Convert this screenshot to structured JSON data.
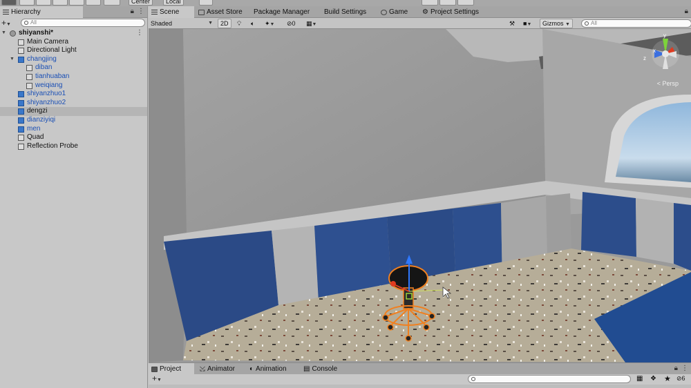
{
  "toolbar": {
    "center_label": "Center",
    "local_label": "Local"
  },
  "hierarchy": {
    "tab_label": "Hierarchy",
    "search_placeholder": "All",
    "items": [
      {
        "label": "shiyanshi*",
        "depth": 0,
        "expanded": true,
        "kind": "scene",
        "bold": true,
        "blue": false
      },
      {
        "label": "Main Camera",
        "depth": 1,
        "kind": "object",
        "blue": false
      },
      {
        "label": "Directional Light",
        "depth": 1,
        "kind": "object",
        "blue": false
      },
      {
        "label": "changjing",
        "depth": 1,
        "expanded": true,
        "kind": "prefab",
        "blue": true
      },
      {
        "label": "diban",
        "depth": 2,
        "kind": "object",
        "blue": true
      },
      {
        "label": "tianhuaban",
        "depth": 2,
        "kind": "object",
        "blue": true
      },
      {
        "label": "weiqiang",
        "depth": 2,
        "kind": "object",
        "blue": true
      },
      {
        "label": "shiyanzhuo1",
        "depth": 1,
        "kind": "prefab",
        "blue": true
      },
      {
        "label": "shiyanzhuo2",
        "depth": 1,
        "kind": "prefab",
        "blue": true
      },
      {
        "label": "dengzi",
        "depth": 1,
        "kind": "prefab",
        "blue": false,
        "selected": true
      },
      {
        "label": "dianziyiqi",
        "depth": 1,
        "kind": "prefab",
        "blue": true
      },
      {
        "label": "men",
        "depth": 1,
        "kind": "prefab",
        "blue": true
      },
      {
        "label": "Quad",
        "depth": 1,
        "kind": "object",
        "blue": false
      },
      {
        "label": "Reflection Probe",
        "depth": 1,
        "kind": "object",
        "blue": false
      }
    ]
  },
  "scene_tabs": [
    {
      "label": "Scene",
      "icon": "scene-icon",
      "active": true
    },
    {
      "label": "Asset Store",
      "icon": "store-icon"
    },
    {
      "label": "Package Manager",
      "icon": "package-icon"
    },
    {
      "label": "Build Settings",
      "icon": ""
    },
    {
      "label": "Game",
      "icon": "game-icon"
    },
    {
      "label": "Project Settings",
      "icon": "gear-icon"
    }
  ],
  "scene_controls": {
    "shading_mode": "Shaded",
    "mode_2d": "2D",
    "hidden_count": "0",
    "gizmos_label": "Gizmos",
    "search_placeholder": "All"
  },
  "viewport": {
    "persp_label": "Persp",
    "axis_labels": {
      "x": "x",
      "y": "y",
      "z": "z"
    }
  },
  "bottom_tabs": [
    {
      "label": "Project",
      "icon": "folder-icon",
      "active": true
    },
    {
      "label": "Animator",
      "icon": "animator-icon"
    },
    {
      "label": "Animation",
      "icon": "animation-icon"
    },
    {
      "label": "Console",
      "icon": "console-icon"
    }
  ],
  "bottom_tools": {
    "hidden_packages_count": "6"
  },
  "colors": {
    "selection_orange": "#f08020",
    "prefab_blue": "#1a4fb5",
    "panel_gray": "#c8c8c8"
  }
}
